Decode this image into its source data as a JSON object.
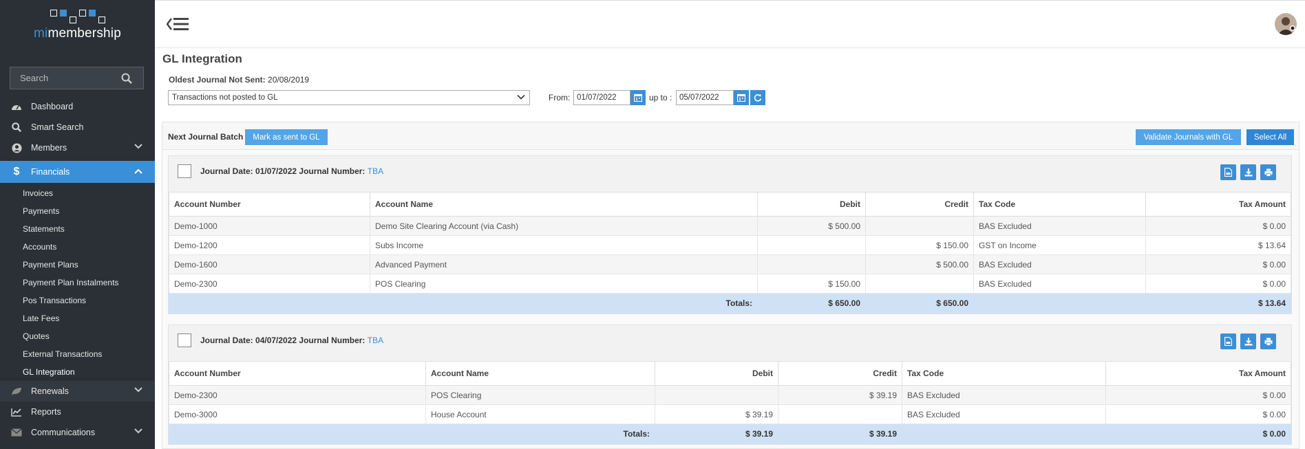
{
  "brand": {
    "prefix": "mi",
    "suffix": "membership"
  },
  "search": {
    "placeholder": "Search"
  },
  "nav": [
    {
      "label": "Dashboard",
      "icon": "dashboard-icon"
    },
    {
      "label": "Smart Search",
      "icon": "search-icon"
    },
    {
      "label": "Members",
      "icon": "user-circle-icon",
      "expandable": true
    }
  ],
  "financials": {
    "label": "Financials",
    "items": [
      "Invoices",
      "Payments",
      "Statements",
      "Accounts",
      "Payment Plans",
      "Payment Plan Instalments",
      "Pos Transactions",
      "Late Fees",
      "Quotes",
      "External Transactions",
      "GL Integration"
    ]
  },
  "nav_bottom": [
    {
      "label": "Renewals",
      "icon": "leaf-icon",
      "expandable": true
    },
    {
      "label": "Reports",
      "icon": "line-chart-icon"
    },
    {
      "label": "Communications",
      "icon": "envelope-icon",
      "expandable": true
    }
  ],
  "page": {
    "title": "GL Integration",
    "oldest_label": "Oldest Journal Not Sent:",
    "oldest_value": "20/08/2019",
    "filter_value": "Transactions not posted to GL",
    "from_label": "From:",
    "from_date": "01/07/2022",
    "upto_label": "up to :",
    "upto_date": "05/07/2022"
  },
  "batch": {
    "label": "Next Journal Batch",
    "mark_sent": "Mark as sent to GL",
    "validate": "Validate Journals with GL",
    "select_all": "Select All"
  },
  "columns": [
    "Account Number",
    "Account Name",
    "Debit",
    "Credit",
    "Tax Code",
    "Tax Amount"
  ],
  "journals": [
    {
      "title": "Journal Date: 01/07/2022 Journal Number:",
      "number": "TBA",
      "rows": [
        [
          "Demo-1000",
          "Demo Site Clearing Account (via Cash)",
          "$ 500.00",
          "",
          "BAS Excluded",
          "$ 0.00"
        ],
        [
          "Demo-1200",
          "Subs Income",
          "",
          "$ 150.00",
          "GST on Income",
          "$ 13.64"
        ],
        [
          "Demo-1600",
          "Advanced Payment",
          "",
          "$ 500.00",
          "BAS Excluded",
          "$ 0.00"
        ],
        [
          "Demo-2300",
          "POS Clearing",
          "$ 150.00",
          "",
          "BAS Excluded",
          "$ 0.00"
        ]
      ],
      "totals": {
        "label": "Totals:",
        "debit": "$ 650.00",
        "credit": "$ 650.00",
        "tax": "$ 13.64"
      }
    },
    {
      "title": "Journal Date: 04/07/2022 Journal Number:",
      "number": "TBA",
      "rows": [
        [
          "Demo-2300",
          "POS Clearing",
          "",
          "$ 39.19",
          "BAS Excluded",
          "$ 0.00"
        ],
        [
          "Demo-3000",
          "House Account",
          "$ 39.19",
          "",
          "BAS Excluded",
          "$ 0.00"
        ]
      ],
      "totals": {
        "label": "Totals:",
        "debit": "$ 39.19",
        "credit": "$ 39.19",
        "tax": "$ 0.00"
      }
    }
  ],
  "colors": {
    "accent": "#3b8fd6",
    "sidebar": "#2a3036",
    "totals": "#cfe2f5"
  }
}
